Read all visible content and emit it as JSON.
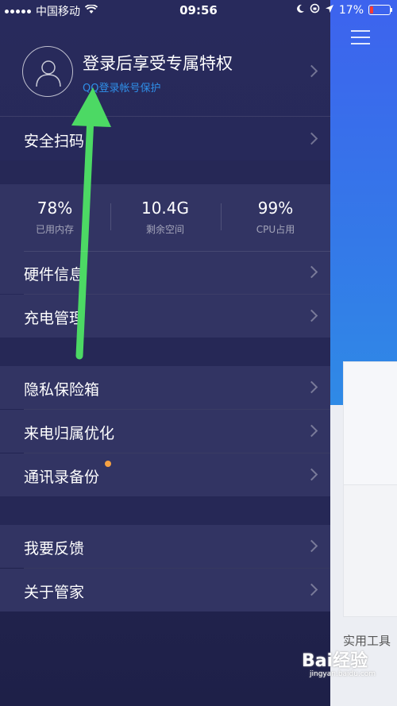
{
  "status": {
    "carrier": "中国移动",
    "time": "09:56",
    "battery": "17%",
    "battery_level": 0.17
  },
  "profile": {
    "title": "登录后享受专属特权",
    "subtitle": "QQ登录帐号保护"
  },
  "menu": {
    "scan": "安全扫码",
    "hardware": "硬件信息",
    "charging": "充电管理",
    "privacy_box": "隐私保险箱",
    "caller_opt": "来电归属优化",
    "contacts_backup": "通讯录备份",
    "feedback": "我要反馈",
    "about": "关于管家"
  },
  "stats": [
    {
      "value": "78%",
      "caption": "已用内存"
    },
    {
      "value": "10.4G",
      "caption": "剩余空间"
    },
    {
      "value": "99%",
      "caption": "CPU占用"
    }
  ],
  "background_app": {
    "tools_label": "实用工具"
  },
  "watermark": {
    "brand": "Bai经验",
    "url": "jingyan.baidu.com"
  },
  "colors": {
    "drawer_bg": "#272958",
    "accent_blue": "#2f8fe8",
    "badge_orange": "#f5a143",
    "arrow_green": "#4cd964"
  }
}
